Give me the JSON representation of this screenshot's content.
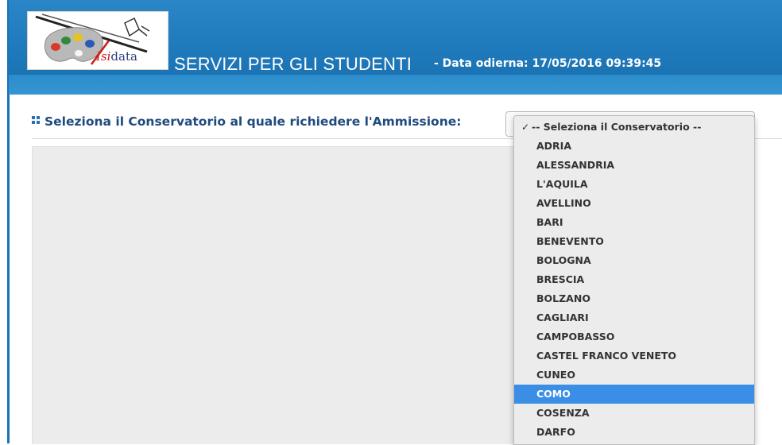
{
  "header": {
    "logo_text_prefix": "Isi",
    "logo_text_suffix": "data",
    "title": "SERVIZI PER GLI STUDENTI",
    "date_text": "- Data odierna: 17/05/2016 09:39:45"
  },
  "section": {
    "title": "Seleziona il Conservatorio al quale richiedere l'Ammissione:"
  },
  "dropdown": {
    "check_mark": "✓",
    "selected_value": "COMO",
    "options": [
      "-- Seleziona il Conservatorio --",
      "ADRIA",
      "ALESSANDRIA",
      "L'AQUILA",
      "AVELLINO",
      "BARI",
      "BENEVENTO",
      "BOLOGNA",
      "BRESCIA",
      "BOLZANO",
      "CAGLIARI",
      "CAMPOBASSO",
      "CASTEL FRANCO VENETO",
      "CUNEO",
      "COMO",
      "COSENZA",
      "DARFO"
    ]
  },
  "colors": {
    "header_blue": "#1f7bbd",
    "title_blue": "#1f4a7e",
    "highlight": "#3a8ee6"
  }
}
